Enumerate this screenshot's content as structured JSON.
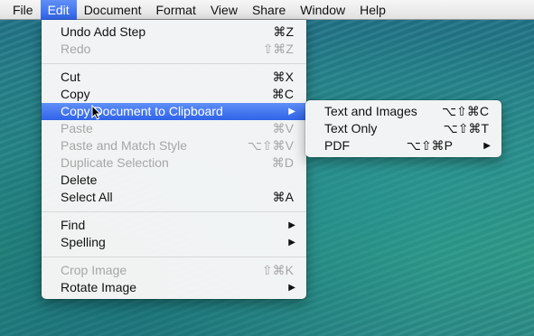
{
  "menubar": {
    "items": [
      "File",
      "Edit",
      "Document",
      "Format",
      "View",
      "Share",
      "Window",
      "Help"
    ],
    "active": "Edit"
  },
  "edit_menu": {
    "undo": {
      "label": "Undo Add Step",
      "shortcut": "⌘Z"
    },
    "redo": {
      "label": "Redo",
      "shortcut": "⇧⌘Z"
    },
    "cut": {
      "label": "Cut",
      "shortcut": "⌘X"
    },
    "copy": {
      "label": "Copy",
      "shortcut": "⌘C"
    },
    "copy_document": {
      "label": "Copy Document to Clipboard",
      "arrow": "▶"
    },
    "paste": {
      "label": "Paste",
      "shortcut": "⌘V"
    },
    "paste_match": {
      "label": "Paste and Match Style",
      "shortcut": "⌥⇧⌘V"
    },
    "duplicate": {
      "label": "Duplicate Selection",
      "shortcut": "⌘D"
    },
    "delete": {
      "label": "Delete"
    },
    "select_all": {
      "label": "Select All",
      "shortcut": "⌘A"
    },
    "find": {
      "label": "Find",
      "arrow": "▶"
    },
    "spelling": {
      "label": "Spelling",
      "arrow": "▶"
    },
    "crop": {
      "label": "Crop Image",
      "shortcut": "⇧⌘K"
    },
    "rotate": {
      "label": "Rotate Image",
      "arrow": "▶"
    }
  },
  "submenu": {
    "text_images": {
      "label": "Text and Images",
      "shortcut": "⌥⇧⌘C"
    },
    "text_only": {
      "label": "Text Only",
      "shortcut": "⌥⇧⌘T"
    },
    "pdf": {
      "label": "PDF",
      "shortcut": "⌥⇧⌘P",
      "arrow": "▶"
    }
  },
  "colors": {
    "highlight": "#2f63e9",
    "disabled_text": "#a6a6a6",
    "menubar_bg": "#e9e9e9"
  }
}
